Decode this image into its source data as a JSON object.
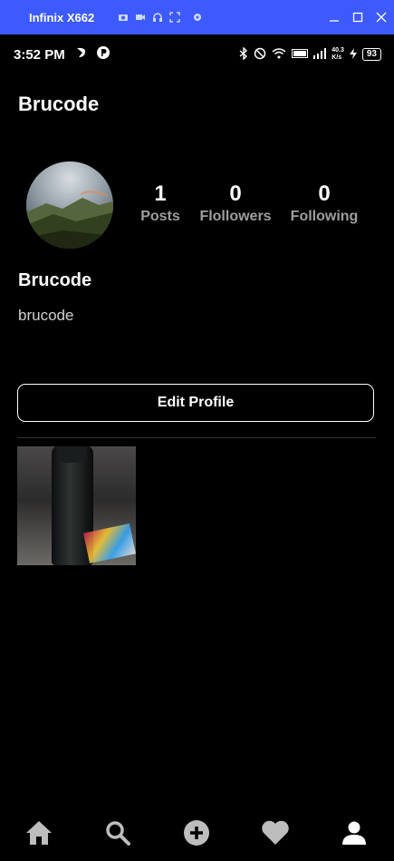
{
  "window": {
    "title": "Infinix X662"
  },
  "status_bar": {
    "time": "3:52 PM",
    "network_speed": "40.3\nK/s",
    "battery": "93"
  },
  "header": {
    "title": "Brucode"
  },
  "profile": {
    "display_name": "Brucode",
    "username": "brucode",
    "stats": [
      {
        "value": "1",
        "label": "Posts"
      },
      {
        "value": "0",
        "label": "Flollowers"
      },
      {
        "value": "0",
        "label": "Following"
      }
    ],
    "edit_button": "Edit Profile"
  },
  "bottom_nav": [
    "home-icon",
    "search-icon",
    "add-icon",
    "heart-icon",
    "profile-icon"
  ],
  "colors": {
    "titlebar": "#3d5afe",
    "background": "#000000",
    "stat_label": "#9e9e9e"
  }
}
